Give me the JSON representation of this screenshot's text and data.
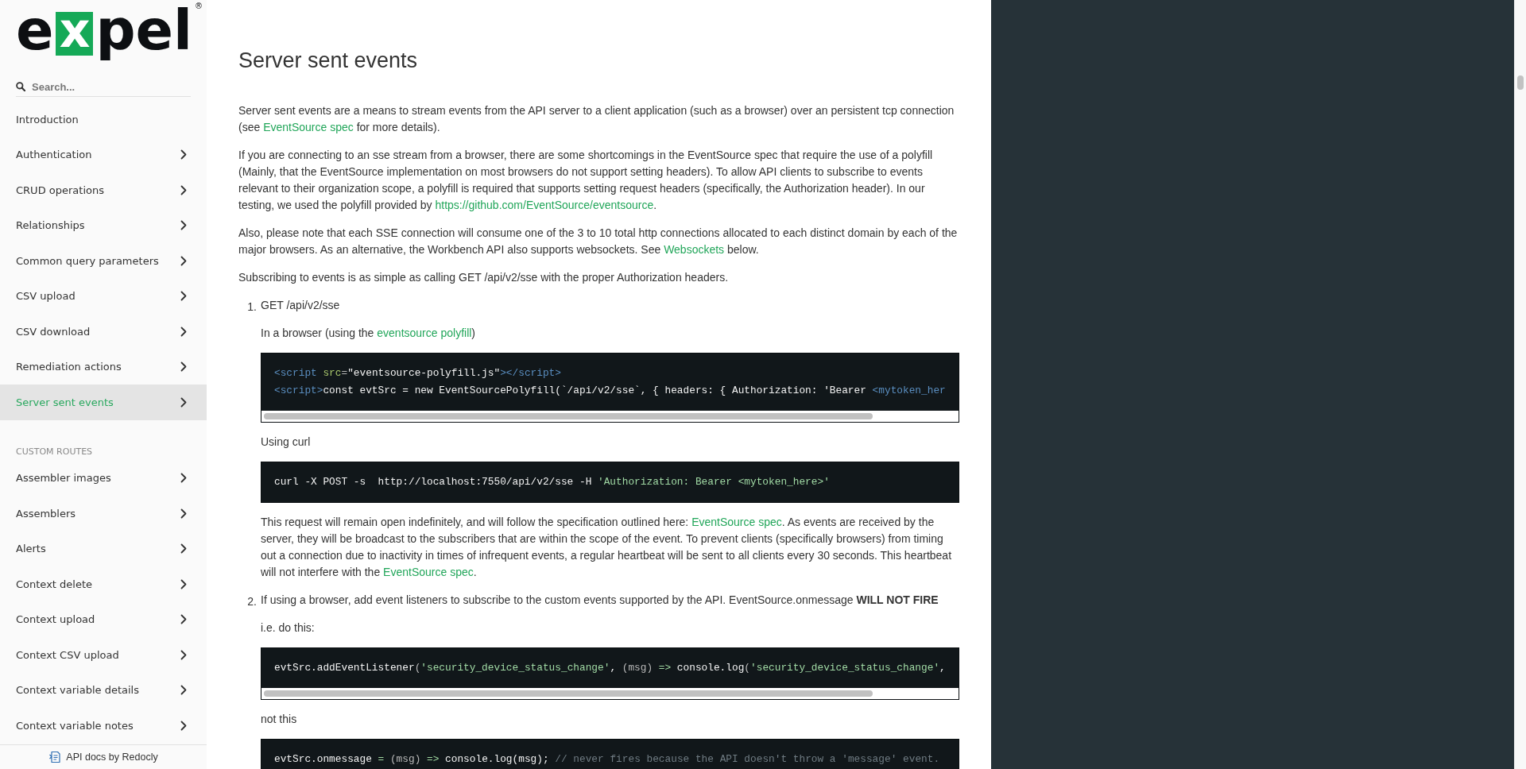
{
  "logo": {
    "before": "e",
    "boxed": "x",
    "after": "pel",
    "mark": "®"
  },
  "search": {
    "placeholder": "Search..."
  },
  "sidebar": {
    "groups": [
      {
        "items": [
          {
            "label": "Introduction",
            "has_children": false,
            "selected": false
          },
          {
            "label": "Authentication",
            "has_children": true,
            "selected": false
          },
          {
            "label": "CRUD operations",
            "has_children": true,
            "selected": false
          },
          {
            "label": "Relationships",
            "has_children": true,
            "selected": false
          },
          {
            "label": "Common query parameters",
            "has_children": true,
            "selected": false
          },
          {
            "label": "CSV upload",
            "has_children": true,
            "selected": false
          },
          {
            "label": "CSV download",
            "has_children": true,
            "selected": false
          },
          {
            "label": "Remediation actions",
            "has_children": true,
            "selected": false
          },
          {
            "label": "Server sent events",
            "has_children": true,
            "selected": true
          }
        ]
      },
      {
        "label": "CUSTOM ROUTES",
        "items": [
          {
            "label": "Assembler images",
            "has_children": true,
            "selected": false
          },
          {
            "label": "Assemblers",
            "has_children": true,
            "selected": false
          },
          {
            "label": "Alerts",
            "has_children": true,
            "selected": false
          },
          {
            "label": "Context delete",
            "has_children": true,
            "selected": false
          },
          {
            "label": "Context upload",
            "has_children": true,
            "selected": false
          },
          {
            "label": "Context CSV upload",
            "has_children": true,
            "selected": false
          },
          {
            "label": "Context variable details",
            "has_children": true,
            "selected": false
          },
          {
            "label": "Context variable notes",
            "has_children": true,
            "selected": false
          }
        ]
      }
    ]
  },
  "footer": {
    "text": "API docs by Redocly"
  },
  "content": {
    "title": "Server sent events",
    "blocks": [
      {
        "kind": "paragraph",
        "parts": [
          {
            "text": "Server sent events are a means to stream events from the API server to a client application (such as a browser) over an persistent tcp connection (see ",
            "link": false
          },
          {
            "text": "EventSource spec",
            "link": true
          },
          {
            "text": " for more details).",
            "link": false
          }
        ]
      },
      {
        "kind": "paragraph",
        "parts": [
          {
            "text": "If you are connecting to an sse stream from a browser, there are some shortcomings in the EventSource spec that require the use of a polyfill (Mainly, that the EventSource implementation on most browsers do not support setting headers). To allow API clients to subscribe to events relevant to their organization scope, a polyfill is required that supports setting request headers (specifically, the Authorization header). In our testing, we used the polyfill provided by ",
            "link": false
          },
          {
            "text": "https://github.com/EventSource/eventsource",
            "link": true
          },
          {
            "text": ".",
            "link": false
          }
        ]
      },
      {
        "kind": "paragraph",
        "parts": [
          {
            "text": "Also, please note that each SSE connection will consume one of the 3 to 10 total http connections allocated to each distinct domain by each of the major browsers. As an alternative, the Workbench API also supports websockets. See ",
            "link": false
          },
          {
            "text": "Websockets",
            "link": true
          },
          {
            "text": " below.",
            "link": false
          }
        ]
      },
      {
        "kind": "paragraph",
        "parts": [
          {
            "text": "Subscribing to events is as simple as calling GET /api/v2/sse with the proper Authorization headers.",
            "link": false
          }
        ]
      },
      {
        "kind": "list",
        "items": [
          {
            "number": "1.",
            "blocks": [
              {
                "kind": "paragraph",
                "parts": [
                  {
                    "text": "GET /api/v2/sse",
                    "link": false
                  }
                ]
              },
              {
                "kind": "paragraph",
                "parts": [
                  {
                    "text": "In a browser (using the ",
                    "link": false
                  },
                  {
                    "text": "eventsource polyfill",
                    "link": true
                  },
                  {
                    "text": ")",
                    "link": false
                  }
                ]
              },
              {
                "kind": "code",
                "has_scrollbar": true,
                "lines": [
                  [
                    {
                      "text": "<script",
                      "kind": "tag"
                    },
                    {
                      "text": " src",
                      "kind": "attr"
                    },
                    {
                      "text": "=",
                      "kind": "punct"
                    },
                    {
                      "text": "\"eventsource-polyfill.js\"",
                      "kind": "plain"
                    },
                    {
                      "text": "></script>",
                      "kind": "tag"
                    }
                  ],
                  [
                    {
                      "text": "<script>",
                      "kind": "tag"
                    },
                    {
                      "text": "const evtSrc = new EventSourcePolyfill(`/api/v2/sse`, { headers: { Authorization: 'Bearer ",
                      "kind": "plain"
                    },
                    {
                      "text": "<mytoken_her",
                      "kind": "tag"
                    }
                  ]
                ]
              },
              {
                "kind": "paragraph",
                "parts": [
                  {
                    "text": "Using curl",
                    "link": false
                  }
                ]
              },
              {
                "kind": "code",
                "has_scrollbar": false,
                "lines": [
                  [
                    {
                      "text": "curl -X POST -s  http://localhost:7550/api/v2/sse -H ",
                      "kind": "plain"
                    },
                    {
                      "text": "'Authorization: Bearer <mytoken_here>'",
                      "kind": "string"
                    }
                  ]
                ]
              },
              {
                "kind": "paragraph",
                "parts": [
                  {
                    "text": "This request will remain open indefinitely, and will follow the specification outlined here: ",
                    "link": false
                  },
                  {
                    "text": "EventSource spec",
                    "link": true
                  },
                  {
                    "text": ". As events are received by the server, they will be broadcast to the subscribers that are within the scope of the event. To prevent clients (specifically browsers) from timing out a connection due to inactivity in times of infrequent events, a regular heartbeat will be sent to all clients every 30 seconds. This heartbeat will not interfere with the ",
                    "link": false
                  },
                  {
                    "text": "EventSource spec",
                    "link": true
                  },
                  {
                    "text": ".",
                    "link": false
                  }
                ]
              }
            ]
          },
          {
            "number": "2.",
            "blocks": [
              {
                "kind": "paragraph",
                "parts": [
                  {
                    "text": "If using a browser, add event listeners to subscribe to the custom events supported by the API. EventSource.onmessage **WILL NOT FIRE**",
                    "link": false
                  }
                ]
              },
              {
                "kind": "paragraph",
                "parts": [
                  {
                    "text": "i.e. do this:",
                    "link": false
                  }
                ]
              },
              {
                "kind": "code",
                "has_scrollbar": true,
                "lines": [
                  [
                    {
                      "text": "evtSrc.addEventListener",
                      "kind": "plain"
                    },
                    {
                      "text": "(",
                      "kind": "punct"
                    },
                    {
                      "text": "'security_device_status_change'",
                      "kind": "string"
                    },
                    {
                      "text": ", ",
                      "kind": "plain"
                    },
                    {
                      "text": "(msg) ",
                      "kind": "punct"
                    },
                    {
                      "text": "=>",
                      "kind": "operator"
                    },
                    {
                      "text": " console.log",
                      "kind": "plain"
                    },
                    {
                      "text": "(",
                      "kind": "punct"
                    },
                    {
                      "text": "'security_device_status_change'",
                      "kind": "string"
                    },
                    {
                      "text": ",",
                      "kind": "plain"
                    }
                  ]
                ]
              },
              {
                "kind": "paragraph",
                "parts": [
                  {
                    "text": "not this",
                    "link": false
                  }
                ]
              },
              {
                "kind": "code",
                "has_scrollbar": false,
                "lines": [
                  [
                    {
                      "text": "evtSrc.onmessage ",
                      "kind": "plain"
                    },
                    {
                      "text": "=",
                      "kind": "operator"
                    },
                    {
                      "text": " (msg) ",
                      "kind": "punct"
                    },
                    {
                      "text": "=>",
                      "kind": "operator"
                    },
                    {
                      "text": " console.log(msg); ",
                      "kind": "plain"
                    },
                    {
                      "text": "// never fires because the API doesn't throw a 'message' event.",
                      "kind": "comment"
                    }
                  ]
                ]
              }
            ]
          }
        ]
      }
    ]
  }
}
